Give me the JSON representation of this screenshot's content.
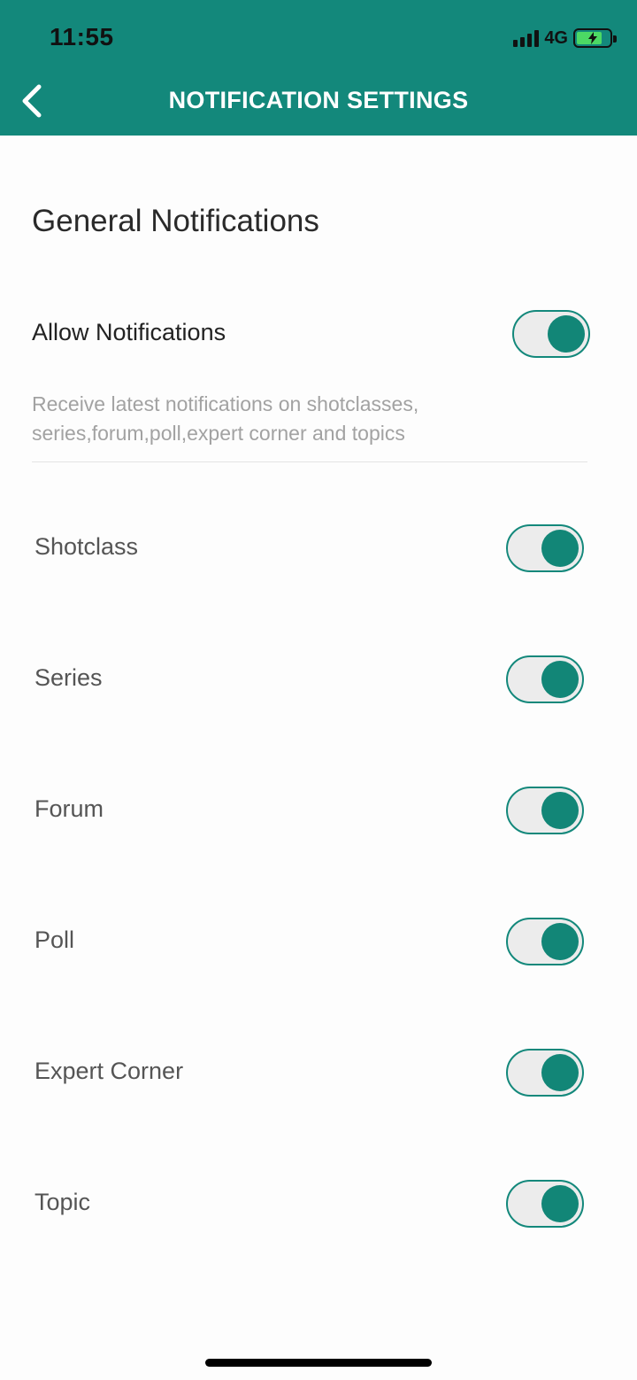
{
  "status_bar": {
    "time": "11:55",
    "network": "4G"
  },
  "header": {
    "title": "NOTIFICATION SETTINGS",
    "icon": "chevron-left-icon"
  },
  "general": {
    "title": "General Notifications",
    "allow_label": "Allow Notifications",
    "allow_enabled": true,
    "description": "Receive latest notifications on shotclasses, series,forum,poll,expert corner and topics"
  },
  "items": [
    {
      "label": "Shotclass",
      "enabled": true
    },
    {
      "label": "Series",
      "enabled": true
    },
    {
      "label": "Forum",
      "enabled": true
    },
    {
      "label": "Poll",
      "enabled": true
    },
    {
      "label": "Expert Corner",
      "enabled": true
    },
    {
      "label": "Topic",
      "enabled": true
    }
  ],
  "colors": {
    "accent": "#13887b",
    "toggle_knob": "#128677",
    "toggle_track": "#ececec"
  }
}
